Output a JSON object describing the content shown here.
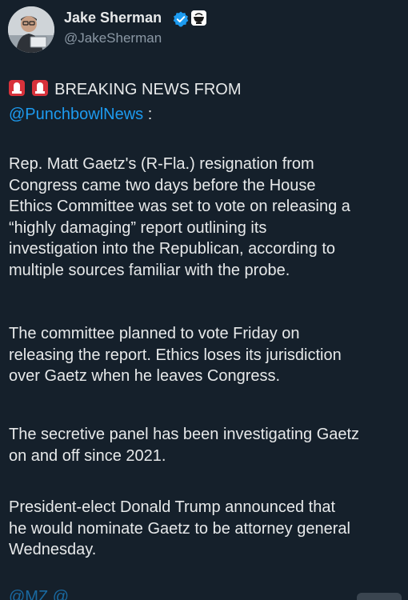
{
  "author": {
    "display_name": "Jake Sherman",
    "handle": "@JakeSherman",
    "verified": true
  },
  "post": {
    "headline_emoji": "siren-icon",
    "headline": "BREAKING NEWS FROM",
    "headline_mention": "@PunchbowlNews",
    "headline_colon": ":",
    "paragraphs": [
      [
        "Rep. Matt Gaetz's (R-Fla.) resignation from",
        "Congress came two days before the House",
        "Ethics Committee was set to vote on releasing a",
        "“highly damaging” report outlining its",
        "investigation into the Republican, according to",
        "multiple sources familiar with the probe."
      ],
      [
        "The committee planned to vote Friday on",
        "releasing the report. Ethics loses its jurisdiction",
        "over Gaetz when he leaves Congress."
      ],
      [
        "The secretive panel has been investigating Gaetz",
        "on and off since 2021."
      ],
      [
        "President-elect Donald Trump announced that",
        "he would nominate Gaetz to be attorney general",
        "Wednesday."
      ]
    ],
    "cutoff_mentions": "@MZ        @                "
  },
  "colors": {
    "background": "#15202b",
    "text": "#e7e9ea",
    "secondary": "#8b98a5",
    "link": "#1d9bf0",
    "verified": "#1d9bf0",
    "siren": "#d8323b"
  }
}
